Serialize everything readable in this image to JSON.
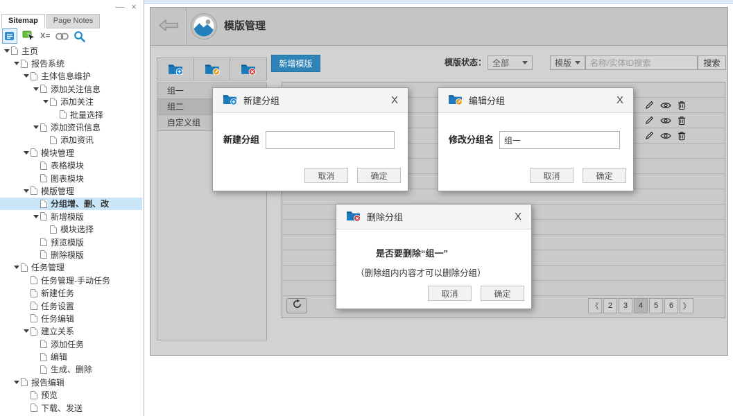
{
  "window": {
    "minimize": "—",
    "close": "×"
  },
  "sidebar": {
    "tabs": [
      {
        "label": "Sitemap",
        "active": true
      },
      {
        "label": "Page Notes",
        "active": false
      }
    ],
    "toolbar": {
      "x_equals": "X="
    },
    "tree": [
      {
        "label": "主页",
        "level": 0,
        "caret": true
      },
      {
        "label": "报告系统",
        "level": 1,
        "caret": true
      },
      {
        "label": "主体信息维护",
        "level": 2,
        "caret": true
      },
      {
        "label": "添加关注信息",
        "level": 3,
        "caret": true
      },
      {
        "label": "添加关注",
        "level": 4,
        "caret": true
      },
      {
        "label": "批量选择",
        "level": 5,
        "caret": false
      },
      {
        "label": "添加资讯信息",
        "level": 3,
        "caret": true
      },
      {
        "label": "添加资讯",
        "level": 4,
        "caret": false
      },
      {
        "label": "模块管理",
        "level": 2,
        "caret": true
      },
      {
        "label": "表格模块",
        "level": 3,
        "caret": false
      },
      {
        "label": "图表模块",
        "level": 3,
        "caret": false
      },
      {
        "label": "模版管理",
        "level": 2,
        "caret": true
      },
      {
        "label": "分组增、删、改",
        "level": 3,
        "caret": false,
        "selected": true
      },
      {
        "label": "新增模版",
        "level": 3,
        "caret": true
      },
      {
        "label": "模块选择",
        "level": 4,
        "caret": false
      },
      {
        "label": "预览模版",
        "level": 3,
        "caret": false
      },
      {
        "label": "删除模版",
        "level": 3,
        "caret": false
      },
      {
        "label": "任务管理",
        "level": 1,
        "caret": true
      },
      {
        "label": "任务管理-手动任务",
        "level": 2,
        "caret": false
      },
      {
        "label": "新建任务",
        "level": 2,
        "caret": false
      },
      {
        "label": "任务设置",
        "level": 2,
        "caret": false
      },
      {
        "label": "任务编辑",
        "level": 2,
        "caret": false
      },
      {
        "label": "建立关系",
        "level": 2,
        "caret": true
      },
      {
        "label": "添加任务",
        "level": 3,
        "caret": false
      },
      {
        "label": "编辑",
        "level": 3,
        "caret": false
      },
      {
        "label": "生成、删除",
        "level": 3,
        "caret": false
      },
      {
        "label": "报告编辑",
        "level": 1,
        "caret": true
      },
      {
        "label": "预览",
        "level": 2,
        "caret": false
      },
      {
        "label": "下载、发送",
        "level": 2,
        "caret": false
      }
    ]
  },
  "main": {
    "header": {
      "title": "模版管理"
    },
    "group_toolbar": [
      {
        "name": "add-group",
        "badge": "add"
      },
      {
        "name": "edit-group",
        "badge": "edit"
      },
      {
        "name": "delete-group",
        "badge": "delete"
      }
    ],
    "groups": [
      {
        "label": "组一",
        "active": false
      },
      {
        "label": "组二",
        "active": true
      },
      {
        "label": "自定义组",
        "active": false
      }
    ],
    "add_template_label": "新增模版",
    "filters": {
      "status_label": "模版状态：",
      "status_value": "全部",
      "type_value": "模版",
      "search_placeholder": "名称/实体ID搜索",
      "search_button": "搜索"
    },
    "table": {
      "row_count": 14,
      "action_rows": [
        1,
        2,
        3
      ]
    },
    "pagination": {
      "prev": "《",
      "pages": [
        "2",
        "3",
        "4",
        "5",
        "6"
      ],
      "current": "4",
      "next": "》"
    }
  },
  "dialogs": {
    "create": {
      "title": "新建分组",
      "label": "新建分组",
      "value": "",
      "cancel": "取消",
      "ok": "确定",
      "close": "X"
    },
    "edit": {
      "title": "编辑分组",
      "label": "修改分组名",
      "value": "组一",
      "cancel": "取消",
      "ok": "确定",
      "close": "X"
    },
    "delete": {
      "title": "删除分组",
      "line1": "是否要删除“组一”",
      "line2": "（删除组内内容才可以删除分组）",
      "cancel": "取消",
      "ok": "确定",
      "close": "X"
    }
  },
  "colors": {
    "accent_blue": "#2e83b8",
    "folder_blue": "#1d7ab8",
    "badge_add": "#1b87d0",
    "badge_edit": "#e79b16",
    "badge_delete": "#d63031",
    "sidebar_selection": "#c8e6f8"
  }
}
